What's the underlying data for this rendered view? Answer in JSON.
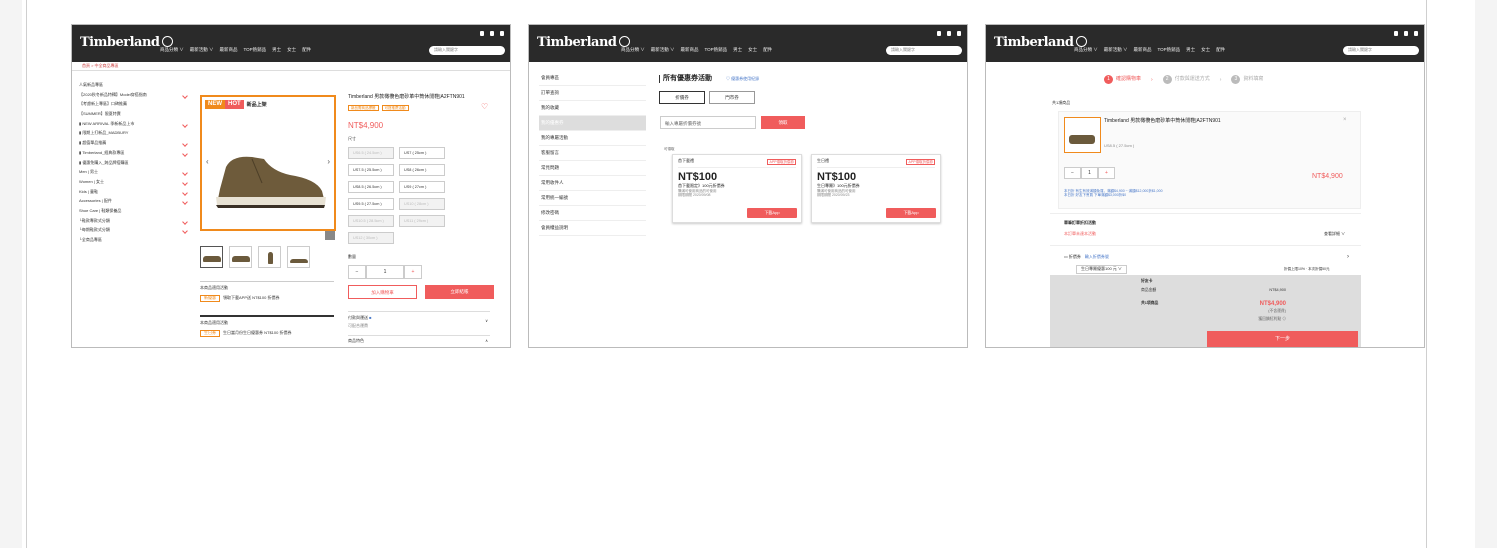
{
  "common": {
    "logo": "Timberland",
    "nav": [
      "商品分類 ∨",
      "最新活動 ∨",
      "最新商品",
      "TOP熱銷品",
      "男士",
      "女士",
      "配件"
    ],
    "search_placeholder": "請輸入關鍵字"
  },
  "shot1": {
    "breadcrumb": "首頁 > 中全商品專區",
    "sidebar": [
      {
        "label": "人氣新品專區",
        "arrow": false
      },
      {
        "label": "【2020秋冬新品特輯】Model穿搭指南",
        "arrow": true
      },
      {
        "label": "【考慮新上專區】口碑推薦",
        "arrow": false
      },
      {
        "label": "【SUMMER】限夏特賣",
        "arrow": false
      },
      {
        "label": "▮ NEW ARRIVAL 季新新品上市",
        "arrow": true
      },
      {
        "label": "▮ 限期上打新品_MADBURY",
        "arrow": false
      },
      {
        "label": "▮ 超值單品推薦",
        "arrow": true
      },
      {
        "label": "▮ Timberland_經典款專區",
        "arrow": true
      },
      {
        "label": "▮ 優惠免購入_跨品牌搭購區",
        "arrow": false
      },
      {
        "label": "Men | 男士",
        "arrow": true
      },
      {
        "label": "Women | 女士",
        "arrow": true
      },
      {
        "label": "Kids | 童鞋",
        "arrow": true
      },
      {
        "label": "Accessories | 配件",
        "arrow": true
      },
      {
        "label": "Shoe Care | 鞋類保養品",
        "arrow": false
      },
      {
        "label": "└鞋款專款式分類",
        "arrow": true
      },
      {
        "label": "└每期鞋款式分類",
        "arrow": true
      },
      {
        "label": "└全商品專區",
        "arrow": false
      }
    ],
    "badge_new": "NEW",
    "badge_hot": "HOT",
    "badge_text": "新品上架",
    "promo1_title": "本商品適用活動",
    "promo1_tag": "新優惠",
    "promo1_text": "領取下載APP送 NT$100 折價券",
    "promo2_title": "本商品適用活動",
    "promo2_tag": "生日券",
    "promo2_text": "生日當月份生日優惠券 NT$100 折價券",
    "product_title": "Timberland 男款橄欖色磨砂革中筒休閒鞋|A2FTN901",
    "tags": [
      "新品需商品標籤",
      "可搭推薦活動"
    ],
    "price": "NT$4,900",
    "size_label": "尺寸",
    "sizes": [
      {
        "label": "US6.5 ( 24.5cm )",
        "disabled": true
      },
      {
        "label": "US7 ( 25cm )",
        "disabled": false
      },
      {
        "label": "US7.5 ( 25.5cm )",
        "disabled": false
      },
      {
        "label": "US8 ( 26cm )",
        "disabled": false
      },
      {
        "label": "US8.5 ( 26.5cm )",
        "disabled": false
      },
      {
        "label": "US9 ( 27cm )",
        "disabled": false
      },
      {
        "label": "US9.5 ( 27.5cm )",
        "disabled": false
      },
      {
        "label": "US10 ( 28cm )",
        "disabled": true
      },
      {
        "label": "US10.5 ( 28.5cm )",
        "disabled": true
      },
      {
        "label": "US11 ( 29cm )",
        "disabled": true
      },
      {
        "label": "US12 ( 30cm )",
        "disabled": true
      }
    ],
    "qty_label": "數量",
    "qty": "1",
    "minus": "−",
    "plus": "+",
    "add_cart": "加入購物車",
    "buy_now": "立即結帳",
    "ship_label": "付款與運送",
    "ship_sub": "可配合運費",
    "desc_label": "商品特色"
  },
  "shot2": {
    "sidebar": [
      "會員專區",
      "訂單查詢",
      "我的收藏",
      "我的優惠券",
      "我的專屬活動",
      "客服留言",
      "常見問題",
      "常用收件人",
      "常用統一編號",
      "修改密碼",
      "會員權益說明"
    ],
    "title": "所有優惠券活動",
    "link": "♡ 優惠券使用紀錄",
    "tabs": [
      "折價券",
      "門市券"
    ],
    "input_placeholder": "輸入專屬折價券號",
    "get_btn": "領取",
    "note": "可領取",
    "coupons": [
      {
        "tag": "首下載禮",
        "badge": "APP領取折價券",
        "amount": "NT$100",
        "desc": "首下載限定》100元折價券",
        "meta1": "購滿可使用商品的可使用",
        "meta2": "期限期間 2020/09/08",
        "btn": "下載App"
      },
      {
        "tag": "生日禮",
        "badge": "APP領取折價券",
        "amount": "NT$100",
        "desc": "生日專屬》100元折價券",
        "meta1": "購滿可使用商品的可使用",
        "meta2": "期限期間 2020/09/23",
        "btn": "下載App"
      }
    ]
  },
  "shot3": {
    "steps": [
      {
        "n": "1",
        "label": "確認購物車"
      },
      {
        "n": "2",
        "label": "付款與運送方式"
      },
      {
        "n": "3",
        "label": "資料填寫"
      }
    ],
    "count": "共1項商品",
    "product_title": "Timberland 男款橄欖色磨砂革中筒休閒鞋|A2FTN901",
    "size": "US8.5 ( 27.5cm )",
    "qty": "1",
    "minus": "−",
    "plus": "+",
    "price": "NT$4,900",
    "promo_line1": "本日折    有生有效滿額免運，滿額$4,900 ~ 滿額$12,000折$1,000",
    "promo_line2": "本日折    好友下會員 下單滿額$3,000折$0",
    "activity_title": "單筆訂單折扣活動",
    "activity_red": "本訂單未達本活動",
    "activity_detail": "查看詳細 ∨",
    "coupon_label": "折價券",
    "coupon_link": "輸入折價券號",
    "coupon_select": "生日專屬優惠100 元",
    "coupon_note": "折價上限10% · 本次折價50元",
    "sum_title": "好友卡",
    "sum_rows": [
      {
        "k": "商品金額",
        "v": "NT$4,900"
      },
      {
        "k": "共1項商品",
        "v": "NT$4,900"
      }
    ],
    "sum_note": "(不含運費)",
    "sum_note2": "獲回饋紅利點 ⊙",
    "next": "下一步"
  },
  "colors": {
    "accent": "#f05c5c",
    "orange": "#f08a1c",
    "header": "#2a2a2a"
  }
}
